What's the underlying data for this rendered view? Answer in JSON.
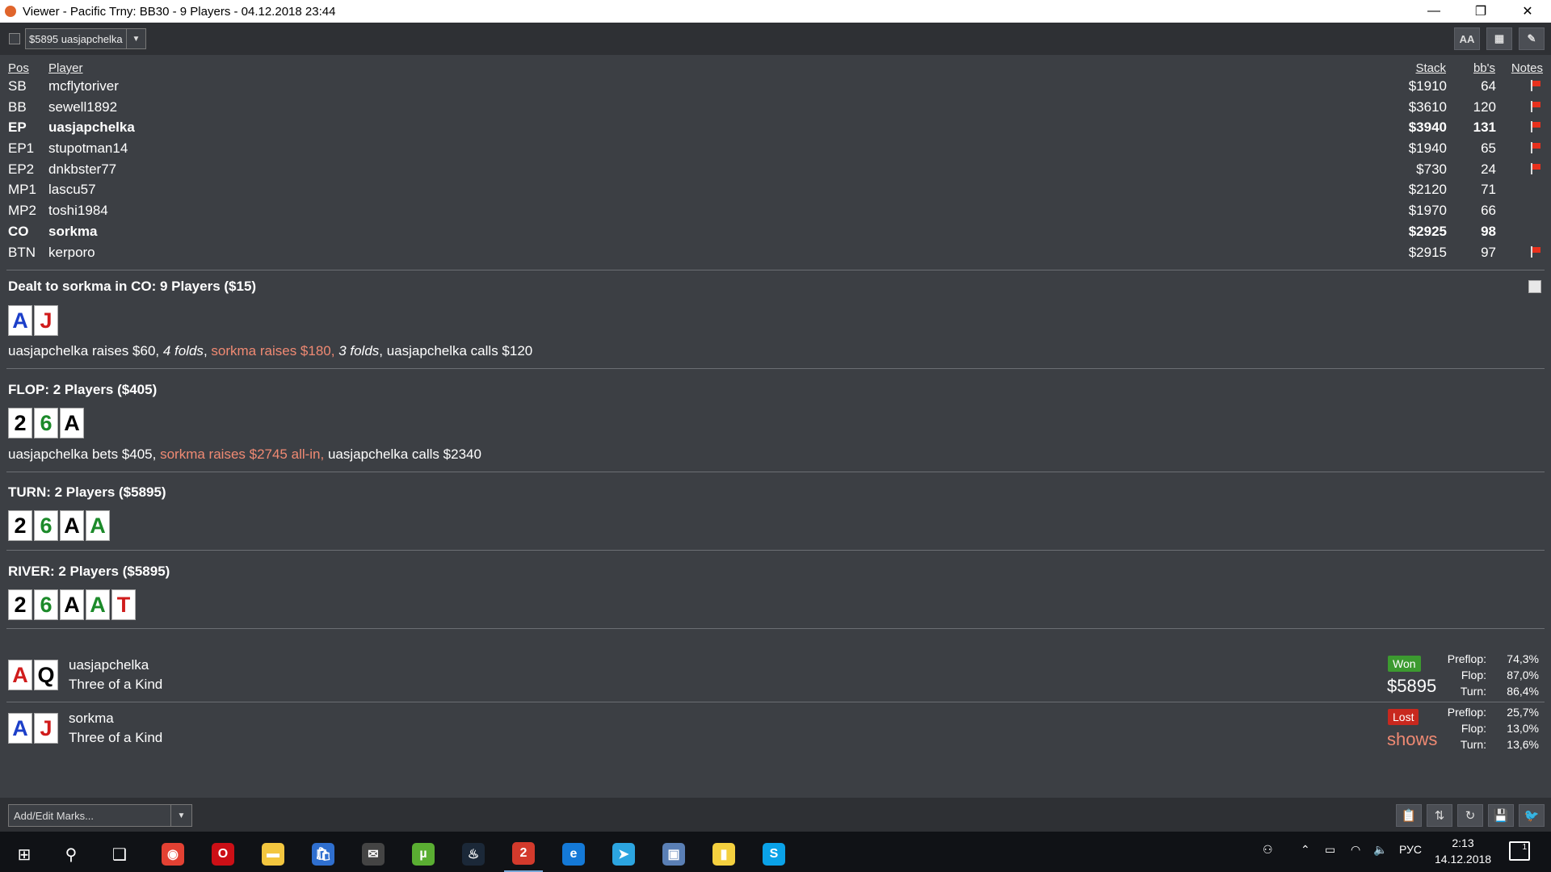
{
  "window": {
    "title": "Viewer - Pacific Trny: BB30 - 9 Players - 04.12.2018 23:44",
    "minimize": "—",
    "maximize": "❐",
    "close": "✕"
  },
  "toolbar": {
    "hand_select": "$5895 uasjapchelka",
    "font_btn": "AA",
    "grid_btn": "▦",
    "edit_btn": "✎"
  },
  "table_headers": {
    "pos": "Pos",
    "player": "Player",
    "stack": "Stack",
    "bbs": "bb's",
    "notes": "Notes"
  },
  "players": [
    {
      "pos": "SB",
      "name": "mcflytoriver",
      "stack": "$1910",
      "bbs": "64",
      "flag": true,
      "bold": false
    },
    {
      "pos": "BB",
      "name": "sewell1892",
      "stack": "$3610",
      "bbs": "120",
      "flag": true,
      "bold": false
    },
    {
      "pos": "EP",
      "name": "uasjapchelka",
      "stack": "$3940",
      "bbs": "131",
      "flag": true,
      "bold": true
    },
    {
      "pos": "EP1",
      "name": "stupotman14",
      "stack": "$1940",
      "bbs": "65",
      "flag": true,
      "bold": false
    },
    {
      "pos": "EP2",
      "name": "dnkbster77",
      "stack": "$730",
      "bbs": "24",
      "flag": true,
      "bold": false
    },
    {
      "pos": "MP1",
      "name": "lascu57",
      "stack": "$2120",
      "bbs": "71",
      "flag": false,
      "bold": false
    },
    {
      "pos": "MP2",
      "name": "toshi1984",
      "stack": "$1970",
      "bbs": "66",
      "flag": false,
      "bold": false
    },
    {
      "pos": "CO",
      "name": "sorkma",
      "stack": "$2925",
      "bbs": "98",
      "flag": false,
      "bold": true
    },
    {
      "pos": "BTN",
      "name": "kerporo",
      "stack": "$2915",
      "bbs": "97",
      "flag": true,
      "bold": false
    }
  ],
  "preflop": {
    "title": "Dealt to sorkma in CO: 9 Players ($15)",
    "cards": [
      {
        "rank": "A",
        "color": "blue"
      },
      {
        "rank": "J",
        "color": "red"
      }
    ],
    "actions": [
      {
        "text": "uasjapchelka raises $60, ",
        "style": ""
      },
      {
        "text": "4 folds",
        "style": "it"
      },
      {
        "text": ", ",
        "style": ""
      },
      {
        "text": "sorkma raises $180, ",
        "style": "hero"
      },
      {
        "text": "3 folds",
        "style": "it"
      },
      {
        "text": ", uasjapchelka calls $120",
        "style": ""
      }
    ]
  },
  "flop": {
    "title": "FLOP: 2 Players ($405)",
    "cards": [
      {
        "rank": "2",
        "color": "black"
      },
      {
        "rank": "6",
        "color": "green"
      },
      {
        "rank": "A",
        "color": "black"
      }
    ],
    "actions": [
      {
        "text": "uasjapchelka bets $405, ",
        "style": ""
      },
      {
        "text": "sorkma raises $2745 all-in, ",
        "style": "hero"
      },
      {
        "text": "uasjapchelka calls $2340",
        "style": ""
      }
    ]
  },
  "turn": {
    "title": "TURN: 2 Players ($5895)",
    "cards": [
      {
        "rank": "2",
        "color": "black"
      },
      {
        "rank": "6",
        "color": "green"
      },
      {
        "rank": "A",
        "color": "black"
      },
      {
        "rank": "A",
        "color": "green"
      }
    ]
  },
  "river": {
    "title": "RIVER: 2 Players ($5895)",
    "cards": [
      {
        "rank": "2",
        "color": "black"
      },
      {
        "rank": "6",
        "color": "green"
      },
      {
        "rank": "A",
        "color": "black"
      },
      {
        "rank": "A",
        "color": "green"
      },
      {
        "rank": "T",
        "color": "red"
      }
    ]
  },
  "showdown": [
    {
      "name": "uasjapchelka",
      "hand": "Three of a Kind",
      "cards": [
        {
          "rank": "A",
          "color": "red"
        },
        {
          "rank": "Q",
          "color": "black"
        }
      ],
      "badge": "Won",
      "result": "won",
      "amount": "$5895",
      "equity": [
        {
          "label": "Preflop:",
          "value": "74,3%"
        },
        {
          "label": "Flop:",
          "value": "87,0%"
        },
        {
          "label": "Turn:",
          "value": "86,4%"
        }
      ]
    },
    {
      "name": "sorkma",
      "hand": "Three of a Kind",
      "cards": [
        {
          "rank": "A",
          "color": "blue"
        },
        {
          "rank": "J",
          "color": "red"
        }
      ],
      "badge": "Lost",
      "result": "lost",
      "amount": "shows",
      "equity": [
        {
          "label": "Preflop:",
          "value": "25,7%"
        },
        {
          "label": "Flop:",
          "value": "13,0%"
        },
        {
          "label": "Turn:",
          "value": "13,6%"
        }
      ]
    }
  ],
  "bottom": {
    "marks_placeholder": "Add/Edit Marks...",
    "clipboard_btn": "📋",
    "sort_btn": "⇅",
    "refresh_btn": "↻",
    "save_btn": "💾",
    "share_btn": "🐦"
  },
  "taskbar": {
    "start_icon": "⊞",
    "search_icon": "⚲",
    "taskview_icon": "❑",
    "apps": [
      {
        "name": "chrome-icon",
        "glyph": "◉",
        "color": "#e34133",
        "active": false
      },
      {
        "name": "opera-icon",
        "glyph": "O",
        "color": "#cc0f16",
        "active": false
      },
      {
        "name": "explorer-icon",
        "glyph": "▬",
        "color": "#f3c63f",
        "active": false
      },
      {
        "name": "store-icon",
        "glyph": "🛍",
        "color": "#2f6fcf",
        "active": false
      },
      {
        "name": "mail-icon",
        "glyph": "✉",
        "color": "#444444",
        "active": false
      },
      {
        "name": "utorrent-icon",
        "glyph": "µ",
        "color": "#5aae32",
        "active": false
      },
      {
        "name": "steam-icon",
        "glyph": "♨",
        "color": "#1b2838",
        "active": false
      },
      {
        "name": "holdem-manager-icon",
        "glyph": "2",
        "color": "#d33a2c",
        "active": true
      },
      {
        "name": "edge-icon",
        "glyph": "e",
        "color": "#1479d7",
        "active": false
      },
      {
        "name": "telegram-icon",
        "glyph": "➤",
        "color": "#2ca5e0",
        "active": false
      },
      {
        "name": "photos-icon",
        "glyph": "▣",
        "color": "#5a7fb5",
        "active": false
      },
      {
        "name": "notes-icon",
        "glyph": "▮",
        "color": "#f4d03f",
        "active": false
      },
      {
        "name": "skype-icon",
        "glyph": "S",
        "color": "#0aa2e8",
        "active": false
      }
    ],
    "lang": "РУС",
    "time": "2:13",
    "date": "14.12.2018",
    "notif_count": "1"
  }
}
